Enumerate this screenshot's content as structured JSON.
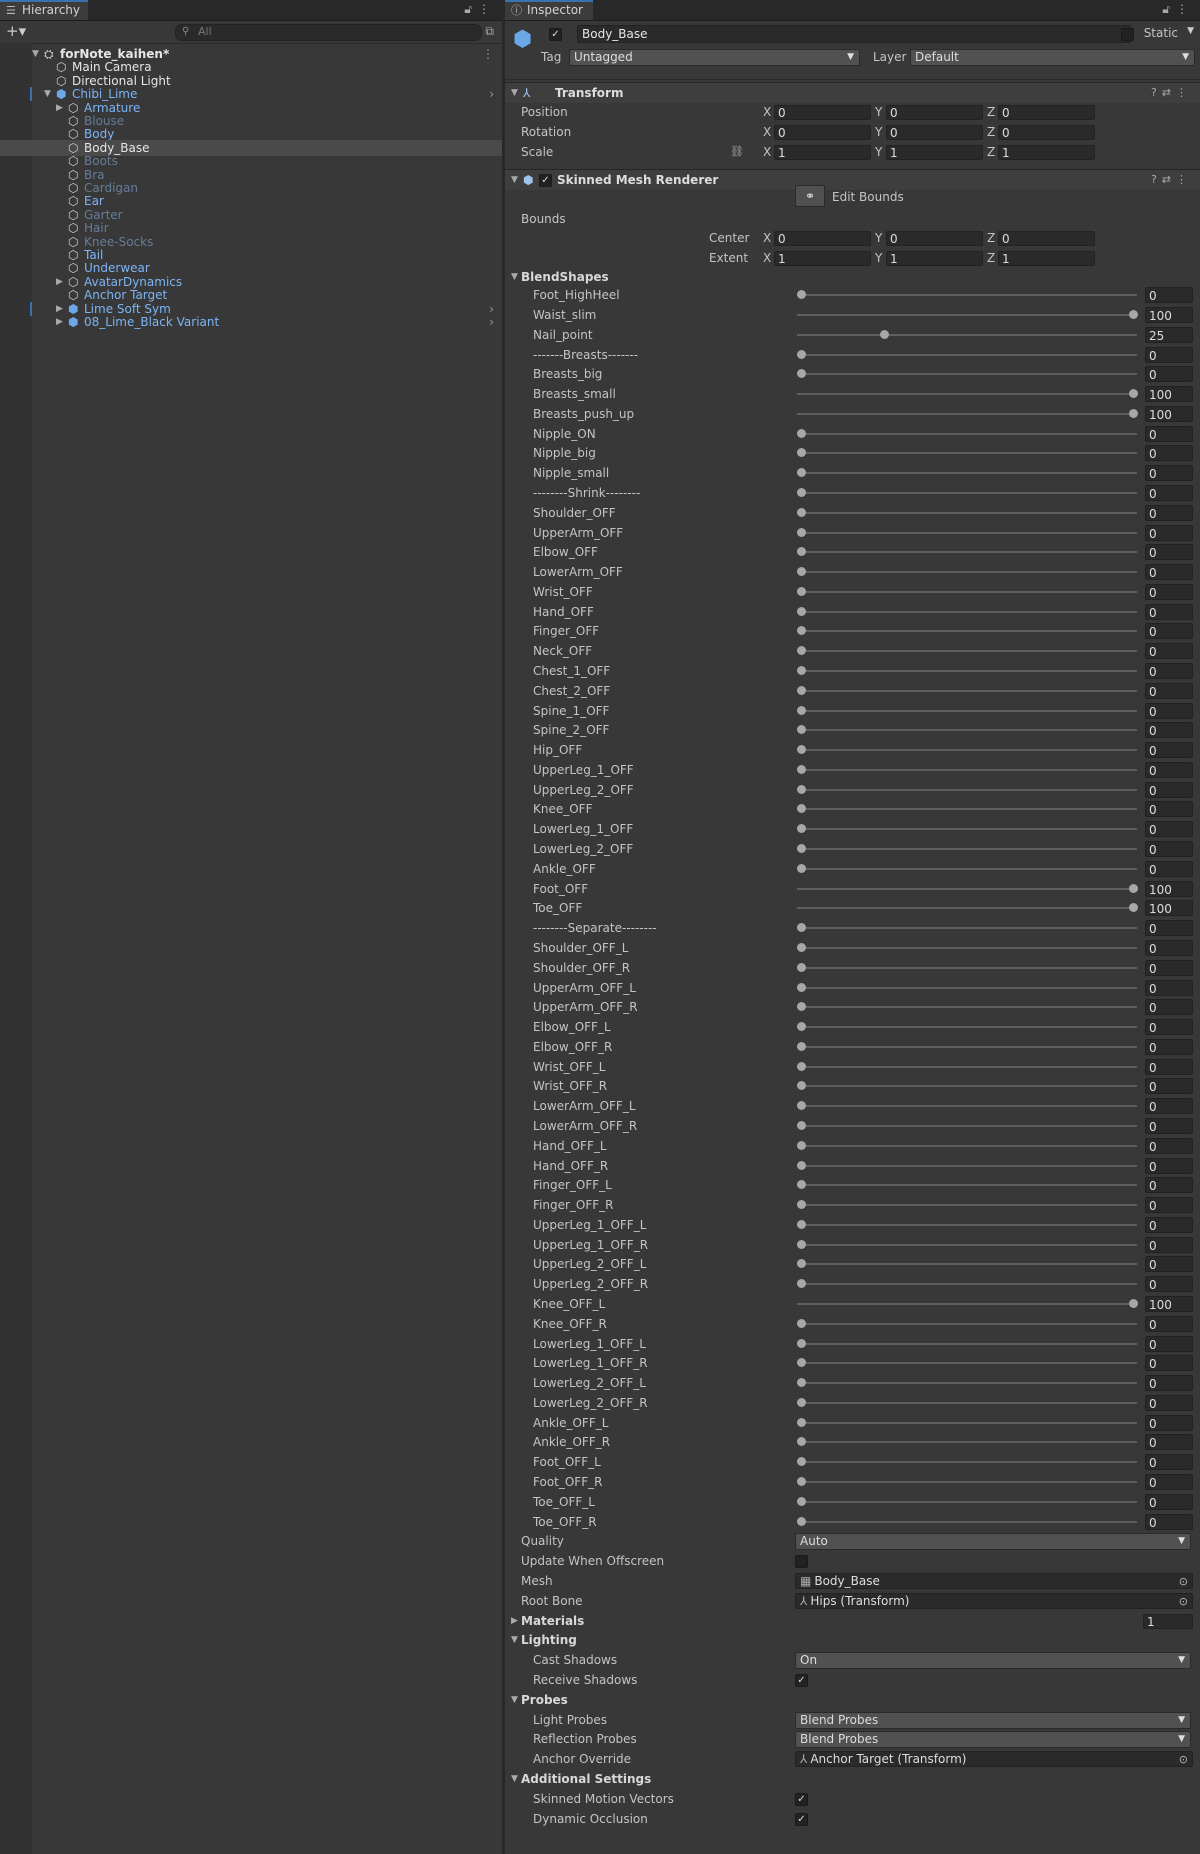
{
  "hierarchy": {
    "tab_label": "Hierarchy",
    "search_placeholder": "All",
    "items": [
      {
        "label": "forNote_kaihen*",
        "depth": 0,
        "arrow": "down",
        "icon": "unity-scene-icon",
        "style": "white",
        "bold": true,
        "more": true
      },
      {
        "label": "Main Camera",
        "depth": 1,
        "arrow": "",
        "icon": "gameobject-cube-icon",
        "style": "white"
      },
      {
        "label": "Directional Light",
        "depth": 1,
        "arrow": "",
        "icon": "gameobject-cube-icon",
        "style": "white"
      },
      {
        "label": "Chibi_Lime",
        "depth": 1,
        "arrow": "down",
        "icon": "prefab-cube-icon",
        "style": "blue",
        "chev": true,
        "bar": true
      },
      {
        "label": "Armature",
        "depth": 2,
        "arrow": "right",
        "icon": "gameobject-cube-icon",
        "style": "blue"
      },
      {
        "label": "Blouse",
        "depth": 2,
        "arrow": "",
        "icon": "gameobject-cube-icon",
        "style": "dim"
      },
      {
        "label": "Body",
        "depth": 2,
        "arrow": "",
        "icon": "gameobject-cube-icon",
        "style": "blue"
      },
      {
        "label": "Body_Base",
        "depth": 2,
        "arrow": "",
        "icon": "gameobject-cube-icon",
        "style": "white",
        "selected": true
      },
      {
        "label": "Boots",
        "depth": 2,
        "arrow": "",
        "icon": "gameobject-cube-icon",
        "style": "dim"
      },
      {
        "label": "Bra",
        "depth": 2,
        "arrow": "",
        "icon": "gameobject-cube-icon",
        "style": "dim"
      },
      {
        "label": "Cardigan",
        "depth": 2,
        "arrow": "",
        "icon": "gameobject-cube-icon",
        "style": "dim"
      },
      {
        "label": "Ear",
        "depth": 2,
        "arrow": "",
        "icon": "gameobject-cube-icon",
        "style": "blue"
      },
      {
        "label": "Garter",
        "depth": 2,
        "arrow": "",
        "icon": "gameobject-cube-icon",
        "style": "dim"
      },
      {
        "label": "Hair",
        "depth": 2,
        "arrow": "",
        "icon": "gameobject-cube-icon",
        "style": "dim"
      },
      {
        "label": "Knee-Socks",
        "depth": 2,
        "arrow": "",
        "icon": "gameobject-cube-icon",
        "style": "dim"
      },
      {
        "label": "Tail",
        "depth": 2,
        "arrow": "",
        "icon": "gameobject-cube-icon",
        "style": "blue"
      },
      {
        "label": "Underwear",
        "depth": 2,
        "arrow": "",
        "icon": "gameobject-cube-icon",
        "style": "blue"
      },
      {
        "label": "AvatarDynamics",
        "depth": 2,
        "arrow": "right",
        "icon": "gameobject-cube-icon",
        "style": "blue"
      },
      {
        "label": "Anchor Target",
        "depth": 2,
        "arrow": "",
        "icon": "gameobject-cube-icon",
        "style": "blue"
      },
      {
        "label": "Lime Soft Sym",
        "depth": 2,
        "arrow": "right",
        "icon": "prefab-cube-icon",
        "style": "blue",
        "chev": true,
        "bar": true
      },
      {
        "label": "08_Lime_Black Variant",
        "depth": 2,
        "arrow": "right",
        "icon": "prefab-variant-icon",
        "style": "blue",
        "chev": true
      }
    ]
  },
  "inspector": {
    "tab_label": "Inspector",
    "object_name": "Body_Base",
    "static_label": "Static",
    "tag_label": "Tag",
    "tag_value": "Untagged",
    "layer_label": "Layer",
    "layer_value": "Default",
    "transform": {
      "title": "Transform",
      "rows": [
        {
          "label": "Position",
          "x": "0",
          "y": "0",
          "z": "0"
        },
        {
          "label": "Rotation",
          "x": "0",
          "y": "0",
          "z": "0"
        },
        {
          "label": "Scale",
          "x": "1",
          "y": "1",
          "z": "1"
        }
      ]
    },
    "smr": {
      "title": "Skinned Mesh Renderer",
      "edit_bounds": "Edit Bounds",
      "bounds_label": "Bounds",
      "center_label": "Center",
      "extent_label": "Extent",
      "center": {
        "x": "0",
        "y": "0",
        "z": "0"
      },
      "extent": {
        "x": "1",
        "y": "1",
        "z": "1"
      },
      "blendshapes_label": "BlendShapes",
      "blendshapes": [
        {
          "name": "Foot_HighHeel",
          "value": 0
        },
        {
          "name": "Waist_slim",
          "value": 100
        },
        {
          "name": "Nail_point",
          "value": 25
        },
        {
          "name": "-------Breasts-------",
          "value": 0
        },
        {
          "name": "Breasts_big",
          "value": 0
        },
        {
          "name": "Breasts_small",
          "value": 100
        },
        {
          "name": "Breasts_push_up",
          "value": 100
        },
        {
          "name": "Nipple_ON",
          "value": 0
        },
        {
          "name": "Nipple_big",
          "value": 0
        },
        {
          "name": "Nipple_small",
          "value": 0
        },
        {
          "name": "--------Shrink--------",
          "value": 0
        },
        {
          "name": "Shoulder_OFF",
          "value": 0
        },
        {
          "name": "UpperArm_OFF",
          "value": 0
        },
        {
          "name": "Elbow_OFF",
          "value": 0
        },
        {
          "name": "LowerArm_OFF",
          "value": 0
        },
        {
          "name": "Wrist_OFF",
          "value": 0
        },
        {
          "name": "Hand_OFF",
          "value": 0
        },
        {
          "name": "Finger_OFF",
          "value": 0
        },
        {
          "name": "Neck_OFF",
          "value": 0
        },
        {
          "name": "Chest_1_OFF",
          "value": 0
        },
        {
          "name": "Chest_2_OFF",
          "value": 0
        },
        {
          "name": "Spine_1_OFF",
          "value": 0
        },
        {
          "name": "Spine_2_OFF",
          "value": 0
        },
        {
          "name": "Hip_OFF",
          "value": 0
        },
        {
          "name": "UpperLeg_1_OFF",
          "value": 0
        },
        {
          "name": "UpperLeg_2_OFF",
          "value": 0
        },
        {
          "name": "Knee_OFF",
          "value": 0
        },
        {
          "name": "LowerLeg_1_OFF",
          "value": 0
        },
        {
          "name": "LowerLeg_2_OFF",
          "value": 0
        },
        {
          "name": "Ankle_OFF",
          "value": 0
        },
        {
          "name": "Foot_OFF",
          "value": 100
        },
        {
          "name": "Toe_OFF",
          "value": 100
        },
        {
          "name": "--------Separate--------",
          "value": 0
        },
        {
          "name": "Shoulder_OFF_L",
          "value": 0
        },
        {
          "name": "Shoulder_OFF_R",
          "value": 0
        },
        {
          "name": "UpperArm_OFF_L",
          "value": 0
        },
        {
          "name": "UpperArm_OFF_R",
          "value": 0
        },
        {
          "name": "Elbow_OFF_L",
          "value": 0
        },
        {
          "name": "Elbow_OFF_R",
          "value": 0
        },
        {
          "name": "Wrist_OFF_L",
          "value": 0
        },
        {
          "name": "Wrist_OFF_R",
          "value": 0
        },
        {
          "name": "LowerArm_OFF_L",
          "value": 0
        },
        {
          "name": "LowerArm_OFF_R",
          "value": 0
        },
        {
          "name": "Hand_OFF_L",
          "value": 0
        },
        {
          "name": "Hand_OFF_R",
          "value": 0
        },
        {
          "name": "Finger_OFF_L",
          "value": 0
        },
        {
          "name": "Finger_OFF_R",
          "value": 0
        },
        {
          "name": "UpperLeg_1_OFF_L",
          "value": 0
        },
        {
          "name": "UpperLeg_1_OFF_R",
          "value": 0
        },
        {
          "name": "UpperLeg_2_OFF_L",
          "value": 0
        },
        {
          "name": "UpperLeg_2_OFF_R",
          "value": 0
        },
        {
          "name": "Knee_OFF_L",
          "value": 100
        },
        {
          "name": "Knee_OFF_R",
          "value": 0
        },
        {
          "name": "LowerLeg_1_OFF_L",
          "value": 0
        },
        {
          "name": "LowerLeg_1_OFF_R",
          "value": 0
        },
        {
          "name": "LowerLeg_2_OFF_L",
          "value": 0
        },
        {
          "name": "LowerLeg_2_OFF_R",
          "value": 0
        },
        {
          "name": "Ankle_OFF_L",
          "value": 0
        },
        {
          "name": "Ankle_OFF_R",
          "value": 0
        },
        {
          "name": "Foot_OFF_L",
          "value": 0
        },
        {
          "name": "Foot_OFF_R",
          "value": 0
        },
        {
          "name": "Toe_OFF_L",
          "value": 0
        },
        {
          "name": "Toe_OFF_R",
          "value": 0
        }
      ],
      "quality_label": "Quality",
      "quality_value": "Auto",
      "update_offscreen_label": "Update When Offscreen",
      "update_offscreen_checked": false,
      "mesh_label": "Mesh",
      "mesh_value": "Body_Base",
      "root_bone_label": "Root Bone",
      "root_bone_value": "Hips (Transform)",
      "materials_label": "Materials",
      "materials_count": "1",
      "lighting_label": "Lighting",
      "cast_shadows_label": "Cast Shadows",
      "cast_shadows_value": "On",
      "receive_shadows_label": "Receive Shadows",
      "receive_shadows_checked": true,
      "probes_label": "Probes",
      "light_probes_label": "Light Probes",
      "light_probes_value": "Blend Probes",
      "reflection_probes_label": "Reflection Probes",
      "reflection_probes_value": "Blend Probes",
      "anchor_override_label": "Anchor Override",
      "anchor_override_value": "Anchor Target (Transform)",
      "additional_label": "Additional Settings",
      "skinned_motion_label": "Skinned Motion Vectors",
      "skinned_motion_checked": true,
      "dynamic_occlusion_label": "Dynamic Occlusion",
      "dynamic_occlusion_checked": true
    }
  }
}
